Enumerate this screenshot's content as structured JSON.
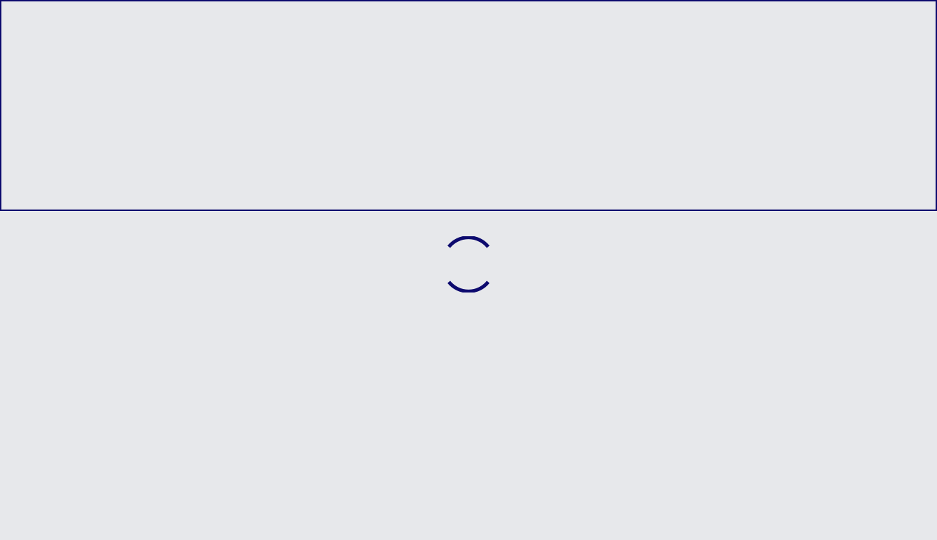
{
  "colors": {
    "background": "#e7e8eb",
    "panel_border": "#0d0a6e",
    "spinner": "#0d0a6e"
  },
  "top_panel": {
    "content": ""
  },
  "loader": {
    "icon": "loading-spinner-icon"
  }
}
